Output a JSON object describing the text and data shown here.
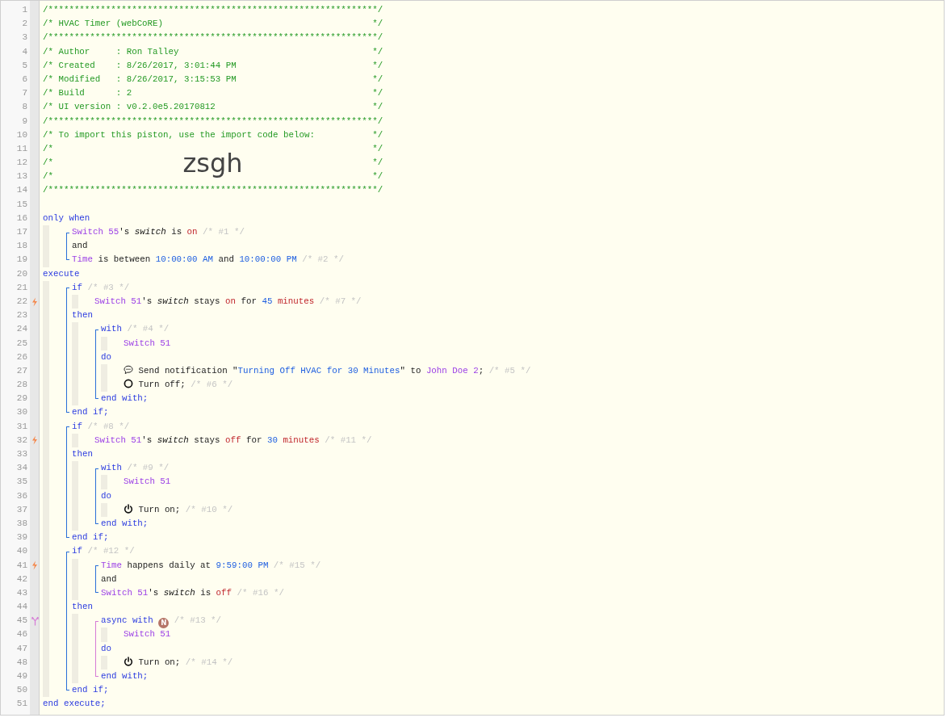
{
  "lines": [
    {
      "number": "1",
      "kind": "banner",
      "tokens": [
        {
          "kind": "header",
          "text": "/***************************************************************/"
        }
      ]
    },
    {
      "number": "2",
      "kind": "banner",
      "tokens": [
        {
          "kind": "header",
          "text": "/* HVAC Timer (webCoRE)"
        },
        {
          "kind": "header",
          "text": "*/"
        }
      ]
    },
    {
      "number": "3",
      "kind": "banner",
      "tokens": [
        {
          "kind": "header",
          "text": "/***************************************************************/"
        }
      ]
    },
    {
      "number": "4",
      "kind": "banner",
      "tokens": [
        {
          "kind": "header",
          "text": "/* Author     : Ron Talley"
        },
        {
          "kind": "header",
          "text": "*/"
        }
      ]
    },
    {
      "number": "5",
      "kind": "banner",
      "tokens": [
        {
          "kind": "header",
          "text": "/* Created    : 8/26/2017, 3:01:44 PM"
        },
        {
          "kind": "header",
          "text": "*/"
        }
      ]
    },
    {
      "number": "6",
      "kind": "banner",
      "tokens": [
        {
          "kind": "header",
          "text": "/* Modified   : 8/26/2017, 3:15:53 PM"
        },
        {
          "kind": "header",
          "text": "*/"
        }
      ]
    },
    {
      "number": "7",
      "kind": "banner",
      "tokens": [
        {
          "kind": "header",
          "text": "/* Build      : 2"
        },
        {
          "kind": "header",
          "text": "*/"
        }
      ]
    },
    {
      "number": "8",
      "kind": "banner",
      "tokens": [
        {
          "kind": "header",
          "text": "/* UI version : v0.2.0e5.20170812"
        },
        {
          "kind": "header",
          "text": "*/"
        }
      ]
    },
    {
      "number": "9",
      "kind": "banner",
      "tokens": [
        {
          "kind": "header",
          "text": "/***************************************************************/"
        }
      ]
    },
    {
      "number": "10",
      "kind": "banner",
      "tokens": [
        {
          "kind": "header",
          "text": "/* To import this piston, use the import code below:"
        },
        {
          "kind": "header",
          "text": "*/"
        }
      ]
    },
    {
      "number": "11",
      "kind": "banner",
      "tokens": [
        {
          "kind": "header",
          "text": "/*"
        },
        {
          "kind": "header",
          "text": "*/"
        }
      ]
    },
    {
      "number": "12",
      "kind": "banner",
      "tokens": [
        {
          "kind": "header",
          "text": "/*"
        },
        {
          "kind": "import",
          "text": "zsgh"
        },
        {
          "kind": "header",
          "text": "*/"
        }
      ]
    },
    {
      "number": "13",
      "kind": "banner",
      "tokens": [
        {
          "kind": "header",
          "text": "/*"
        },
        {
          "kind": "header",
          "text": "*/"
        }
      ]
    },
    {
      "number": "14",
      "kind": "banner",
      "tokens": [
        {
          "kind": "header",
          "text": "/***************************************************************/"
        }
      ]
    },
    {
      "number": "15",
      "kind": "code"
    },
    {
      "number": "16",
      "kind": "code",
      "tokens": [
        {
          "kind": "keyword",
          "text": "only when"
        }
      ]
    },
    {
      "number": "17",
      "kind": "code",
      "guides": [
        {
          "kind": "top"
        }
      ],
      "tokens": [
        {
          "kind": "device",
          "text": "Switch 55"
        },
        {
          "kind": "suffix",
          "text": "'s"
        },
        {
          "kind": "attribute",
          "text": "switch"
        },
        {
          "kind": "plain",
          "text": "is"
        },
        {
          "kind": "value",
          "text": "on"
        },
        {
          "kind": "comment",
          "text": "/* #1 */"
        }
      ]
    },
    {
      "number": "18",
      "kind": "code",
      "guides": [
        {
          "kind": "mid"
        }
      ],
      "tokens": [
        {
          "kind": "plain",
          "text": "and"
        }
      ]
    },
    {
      "number": "19",
      "kind": "code",
      "guides": [
        {
          "kind": "bottom"
        }
      ],
      "tokens": [
        {
          "kind": "device",
          "text": "Time"
        },
        {
          "kind": "plain",
          "text": "is between"
        },
        {
          "kind": "number",
          "text": "10:00:00 AM"
        },
        {
          "kind": "plain",
          "text": "and"
        },
        {
          "kind": "number",
          "text": "10:00:00 PM"
        },
        {
          "kind": "comment",
          "text": "/* #2 */"
        }
      ]
    },
    {
      "number": "20",
      "kind": "code",
      "tokens": [
        {
          "kind": "keyword",
          "text": "execute"
        }
      ]
    },
    {
      "number": "21",
      "kind": "code",
      "guides": [
        {
          "kind": "top"
        }
      ],
      "tokens": [
        {
          "kind": "keyword",
          "text": "if"
        },
        {
          "kind": "comment",
          "text": "/* #3 */"
        }
      ]
    },
    {
      "number": "22",
      "kind": "code",
      "marker": {
        "kind": "trigger"
      },
      "guides": [
        {
          "kind": "mid"
        },
        {
          "kind": "bar"
        }
      ],
      "tokens": [
        {
          "kind": "device",
          "text": "Switch 51"
        },
        {
          "kind": "suffix",
          "text": "'s"
        },
        {
          "kind": "attribute",
          "text": "switch"
        },
        {
          "kind": "plain",
          "text": "stays"
        },
        {
          "kind": "value",
          "text": "on"
        },
        {
          "kind": "plain",
          "text": "for"
        },
        {
          "kind": "number",
          "text": "45"
        },
        {
          "kind": "value",
          "text": "minutes"
        },
        {
          "kind": "comment",
          "text": "/* #7 */"
        }
      ]
    },
    {
      "number": "23",
      "kind": "code",
      "guides": [
        {
          "kind": "mid"
        }
      ],
      "tokens": [
        {
          "kind": "keyword",
          "text": "then"
        }
      ]
    },
    {
      "number": "24",
      "kind": "code",
      "guides": [
        {
          "kind": "mid"
        },
        {
          "kind": "top"
        }
      ],
      "tokens": [
        {
          "kind": "keyword",
          "text": "with"
        },
        {
          "kind": "comment",
          "text": "/* #4 */"
        }
      ]
    },
    {
      "number": "25",
      "kind": "code",
      "guides": [
        {
          "kind": "mid"
        },
        {
          "kind": "mid"
        },
        {
          "kind": "bar"
        }
      ],
      "tokens": [
        {
          "kind": "device",
          "text": "Switch 51"
        }
      ]
    },
    {
      "number": "26",
      "kind": "code",
      "guides": [
        {
          "kind": "mid"
        },
        {
          "kind": "mid"
        }
      ],
      "tokens": [
        {
          "kind": "keyword",
          "text": "do"
        }
      ]
    },
    {
      "number": "27",
      "kind": "code",
      "guides": [
        {
          "kind": "mid"
        },
        {
          "kind": "mid"
        },
        {
          "kind": "bar"
        }
      ],
      "tokens": [
        {
          "kind": "speech"
        },
        {
          "kind": "plain",
          "text": "Send notification \""
        },
        {
          "kind": "string",
          "text": "Turning Off HVAC for 30 Minutes"
        },
        {
          "kind": "suffix",
          "text": "\""
        },
        {
          "kind": "plain",
          "text": "to"
        },
        {
          "kind": "device",
          "text": "John Doe 2"
        },
        {
          "kind": "suffix",
          "text": ";"
        },
        {
          "kind": "comment",
          "text": "/* #5 */"
        }
      ]
    },
    {
      "number": "28",
      "kind": "code",
      "guides": [
        {
          "kind": "mid"
        },
        {
          "kind": "mid"
        },
        {
          "kind": "bar"
        }
      ],
      "tokens": [
        {
          "kind": "ring"
        },
        {
          "kind": "plain",
          "text": "Turn off;"
        },
        {
          "kind": "comment",
          "text": "/* #6 */"
        }
      ]
    },
    {
      "number": "29",
      "kind": "code",
      "guides": [
        {
          "kind": "mid"
        },
        {
          "kind": "bottom"
        }
      ],
      "tokens": [
        {
          "kind": "keyword",
          "text": "end with;"
        }
      ]
    },
    {
      "number": "30",
      "kind": "code",
      "guides": [
        {
          "kind": "bottom"
        }
      ],
      "tokens": [
        {
          "kind": "keyword",
          "text": "end if;"
        }
      ]
    },
    {
      "number": "31",
      "kind": "code",
      "guides": [
        {
          "kind": "top"
        }
      ],
      "tokens": [
        {
          "kind": "keyword",
          "text": "if"
        },
        {
          "kind": "comment",
          "text": "/* #8 */"
        }
      ]
    },
    {
      "number": "32",
      "kind": "code",
      "marker": {
        "kind": "trigger"
      },
      "guides": [
        {
          "kind": "mid"
        },
        {
          "kind": "bar"
        }
      ],
      "tokens": [
        {
          "kind": "device",
          "text": "Switch 51"
        },
        {
          "kind": "suffix",
          "text": "'s"
        },
        {
          "kind": "attribute",
          "text": "switch"
        },
        {
          "kind": "plain",
          "text": "stays"
        },
        {
          "kind": "value",
          "text": "off"
        },
        {
          "kind": "plain",
          "text": "for"
        },
        {
          "kind": "number",
          "text": "30"
        },
        {
          "kind": "value",
          "text": "minutes"
        },
        {
          "kind": "comment",
          "text": "/* #11 */"
        }
      ]
    },
    {
      "number": "33",
      "kind": "code",
      "guides": [
        {
          "kind": "mid"
        }
      ],
      "tokens": [
        {
          "kind": "keyword",
          "text": "then"
        }
      ]
    },
    {
      "number": "34",
      "kind": "code",
      "guides": [
        {
          "kind": "mid"
        },
        {
          "kind": "top"
        }
      ],
      "tokens": [
        {
          "kind": "keyword",
          "text": "with"
        },
        {
          "kind": "comment",
          "text": "/* #9 */"
        }
      ]
    },
    {
      "number": "35",
      "kind": "code",
      "guides": [
        {
          "kind": "mid"
        },
        {
          "kind": "mid"
        },
        {
          "kind": "bar"
        }
      ],
      "tokens": [
        {
          "kind": "device",
          "text": "Switch 51"
        }
      ]
    },
    {
      "number": "36",
      "kind": "code",
      "guides": [
        {
          "kind": "mid"
        },
        {
          "kind": "mid"
        }
      ],
      "tokens": [
        {
          "kind": "keyword",
          "text": "do"
        }
      ]
    },
    {
      "number": "37",
      "kind": "code",
      "guides": [
        {
          "kind": "mid"
        },
        {
          "kind": "mid"
        },
        {
          "kind": "bar"
        }
      ],
      "tokens": [
        {
          "kind": "power"
        },
        {
          "kind": "plain",
          "text": "Turn on;"
        },
        {
          "kind": "comment",
          "text": "/* #10 */"
        }
      ]
    },
    {
      "number": "38",
      "kind": "code",
      "guides": [
        {
          "kind": "mid"
        },
        {
          "kind": "bottom"
        }
      ],
      "tokens": [
        {
          "kind": "keyword",
          "text": "end with;"
        }
      ]
    },
    {
      "number": "39",
      "kind": "code",
      "guides": [
        {
          "kind": "bottom"
        }
      ],
      "tokens": [
        {
          "kind": "keyword",
          "text": "end if;"
        }
      ]
    },
    {
      "number": "40",
      "kind": "code",
      "guides": [
        {
          "kind": "top"
        }
      ],
      "tokens": [
        {
          "kind": "keyword",
          "text": "if"
        },
        {
          "kind": "comment",
          "text": "/* #12 */"
        }
      ]
    },
    {
      "number": "41",
      "kind": "code",
      "marker": {
        "kind": "trigger"
      },
      "guides": [
        {
          "kind": "mid"
        },
        {
          "kind": "top"
        }
      ],
      "tokens": [
        {
          "kind": "device",
          "text": "Time"
        },
        {
          "kind": "plain",
          "text": "happens daily at"
        },
        {
          "kind": "number",
          "text": "9:59:00 PM"
        },
        {
          "kind": "comment",
          "text": "/* #15 */"
        }
      ]
    },
    {
      "number": "42",
      "kind": "code",
      "guides": [
        {
          "kind": "mid"
        },
        {
          "kind": "mid"
        }
      ],
      "tokens": [
        {
          "kind": "plain",
          "text": "and"
        }
      ]
    },
    {
      "number": "43",
      "kind": "code",
      "guides": [
        {
          "kind": "mid"
        },
        {
          "kind": "bottom"
        }
      ],
      "tokens": [
        {
          "kind": "device",
          "text": "Switch 51"
        },
        {
          "kind": "suffix",
          "text": "'s"
        },
        {
          "kind": "attribute",
          "text": "switch"
        },
        {
          "kind": "plain",
          "text": "is"
        },
        {
          "kind": "value",
          "text": "off"
        },
        {
          "kind": "comment",
          "text": "/* #16 */"
        }
      ]
    },
    {
      "number": "44",
      "kind": "code",
      "guides": [
        {
          "kind": "mid"
        }
      ],
      "tokens": [
        {
          "kind": "keyword",
          "text": "then"
        }
      ]
    },
    {
      "number": "45",
      "kind": "code",
      "marker": {
        "kind": "async"
      },
      "guides": [
        {
          "kind": "mid"
        },
        {
          "kind": "async-top"
        }
      ],
      "tokens": [
        {
          "kind": "keyword",
          "text": "async with"
        },
        {
          "kind": "badge",
          "text": "N"
        },
        {
          "kind": "comment",
          "text": "/* #13 */"
        }
      ]
    },
    {
      "number": "46",
      "kind": "code",
      "guides": [
        {
          "kind": "mid"
        },
        {
          "kind": "async-mid"
        },
        {
          "kind": "bar"
        }
      ],
      "tokens": [
        {
          "kind": "device",
          "text": "Switch 51"
        }
      ]
    },
    {
      "number": "47",
      "kind": "code",
      "guides": [
        {
          "kind": "mid"
        },
        {
          "kind": "async-mid"
        }
      ],
      "tokens": [
        {
          "kind": "keyword",
          "text": "do"
        }
      ]
    },
    {
      "number": "48",
      "kind": "code",
      "guides": [
        {
          "kind": "mid"
        },
        {
          "kind": "async-mid"
        },
        {
          "kind": "bar"
        }
      ],
      "tokens": [
        {
          "kind": "power"
        },
        {
          "kind": "plain",
          "text": "Turn on;"
        },
        {
          "kind": "comment",
          "text": "/* #14 */"
        }
      ]
    },
    {
      "number": "49",
      "kind": "code",
      "guides": [
        {
          "kind": "mid"
        },
        {
          "kind": "async-bottom"
        }
      ],
      "tokens": [
        {
          "kind": "keyword",
          "text": "end with;"
        }
      ]
    },
    {
      "number": "50",
      "kind": "code",
      "guides": [
        {
          "kind": "bottom"
        }
      ],
      "tokens": [
        {
          "kind": "keyword",
          "text": "end if;"
        }
      ]
    },
    {
      "number": "51",
      "kind": "code",
      "tokens": [
        {
          "kind": "keyword",
          "text": "end execute;"
        }
      ]
    }
  ]
}
